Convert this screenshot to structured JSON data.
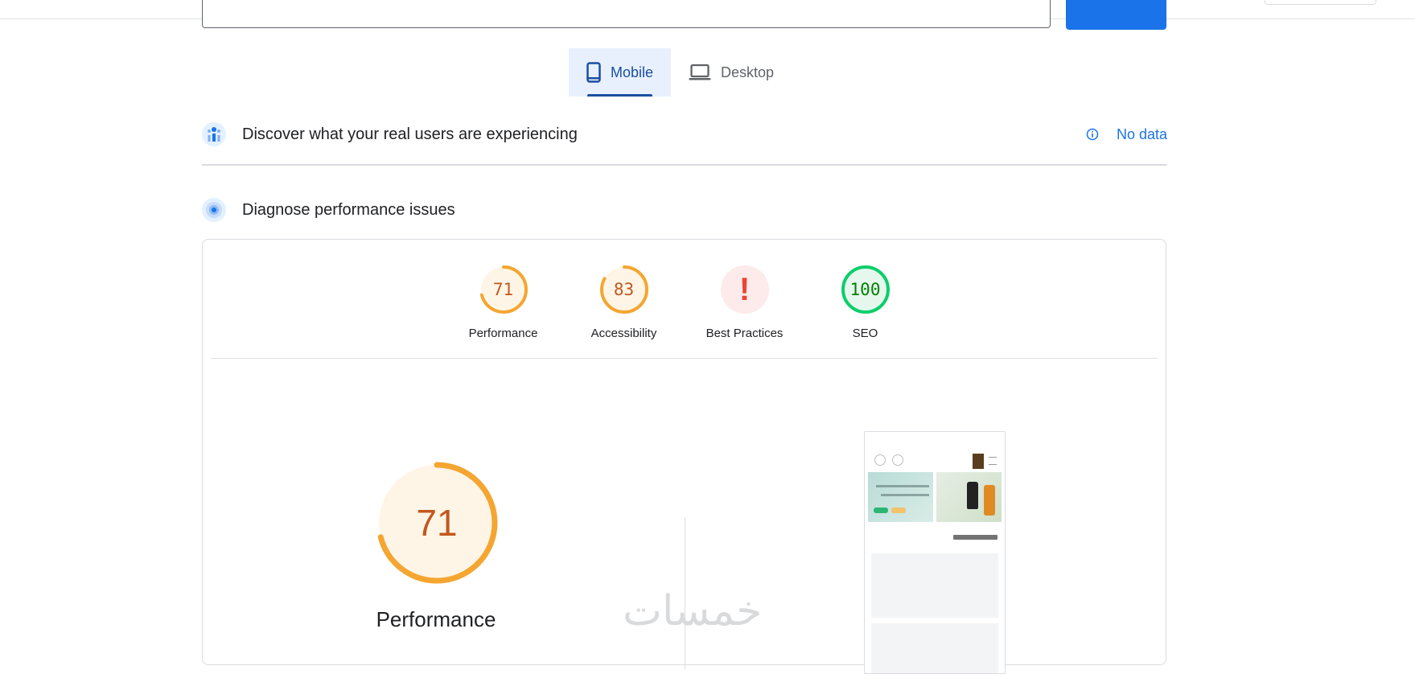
{
  "tabs": [
    {
      "label": "Mobile",
      "active": true,
      "icon": "smartphone-icon"
    },
    {
      "label": "Desktop",
      "active": false,
      "icon": "laptop-icon"
    }
  ],
  "field_data": {
    "title": "Discover what your real users are experiencing",
    "status": "No data",
    "icon": "users-chart-icon",
    "status_icon": "info-icon"
  },
  "lab_data": {
    "title": "Diagnose performance issues",
    "icon": "target-icon"
  },
  "scores": [
    {
      "name": "performance",
      "label": "Performance",
      "value": "71",
      "score": 71,
      "type": "average",
      "color": "#f4a631",
      "text_color": "#c2581f",
      "fill": "#fff5e6"
    },
    {
      "name": "accessibility",
      "label": "Accessibility",
      "value": "83",
      "score": 83,
      "type": "average",
      "color": "#f4a631",
      "text_color": "#c2581f",
      "fill": "#fff5e6"
    },
    {
      "name": "best-practices",
      "label": "Best Practices",
      "value": "!",
      "score": null,
      "type": "error",
      "color": "#eb4335",
      "text_color": "#eb4335",
      "fill": "#fdeaea"
    },
    {
      "name": "seo",
      "label": "SEO",
      "value": "100",
      "score": 100,
      "type": "pass",
      "color": "#0cce6b",
      "text_color": "#008000",
      "fill": "#e6f8ee"
    }
  ],
  "main_score": {
    "label": "Performance",
    "value": "71",
    "score": 71,
    "color": "#f4a631",
    "fill": "#fff5e6"
  },
  "watermark": "خمسات",
  "colors": {
    "accent": "#1a73e8",
    "active_tab": "#1a4fa0",
    "active_tab_bg": "#e8f0fe"
  }
}
